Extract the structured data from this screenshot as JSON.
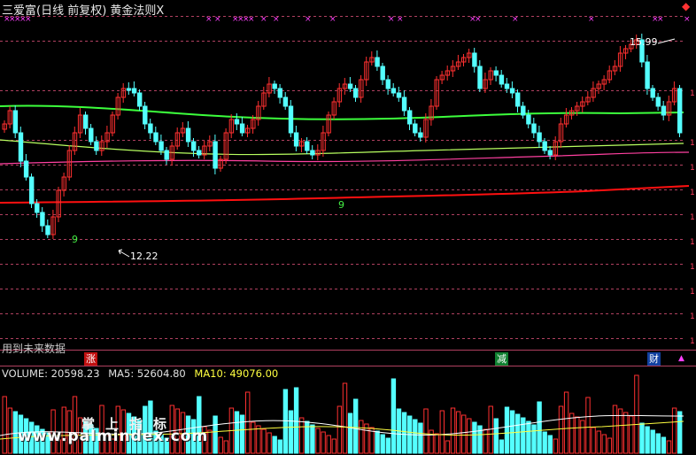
{
  "header": {
    "title": "三爱富(日线 前复权) 黄金法则",
    "close_glyph": "X",
    "alert_glyph": "◆"
  },
  "annotations": {
    "high_label": "15.99",
    "low_label": "12.22",
    "nine_a": "9",
    "nine_b": "9",
    "future_data_label": "用到未来数据"
  },
  "signal_tags": {
    "zhang": "涨",
    "jian": "减",
    "cai": "财",
    "up_mark": "▲"
  },
  "volume_panel": {
    "volume_label": "VOLUME: 20598.23",
    "ma5_label": "MA5: 52604.80",
    "ma10_label": "MA10: 49076.00"
  },
  "watermark": {
    "cn": "掌上指标",
    "url": "www.palmindex.com"
  },
  "colors": {
    "up": "#ff3030",
    "down": "#54ffff",
    "ma_green": "#3cff3c",
    "ma_lightgreen": "#b8ff60",
    "ma_pink": "#ff40a0",
    "ma_red": "#ff1010",
    "grid": "#b04060",
    "marker": "#ff40ff",
    "vol_ma5": "#ffffff",
    "vol_ma10": "#ffff40"
  }
}
